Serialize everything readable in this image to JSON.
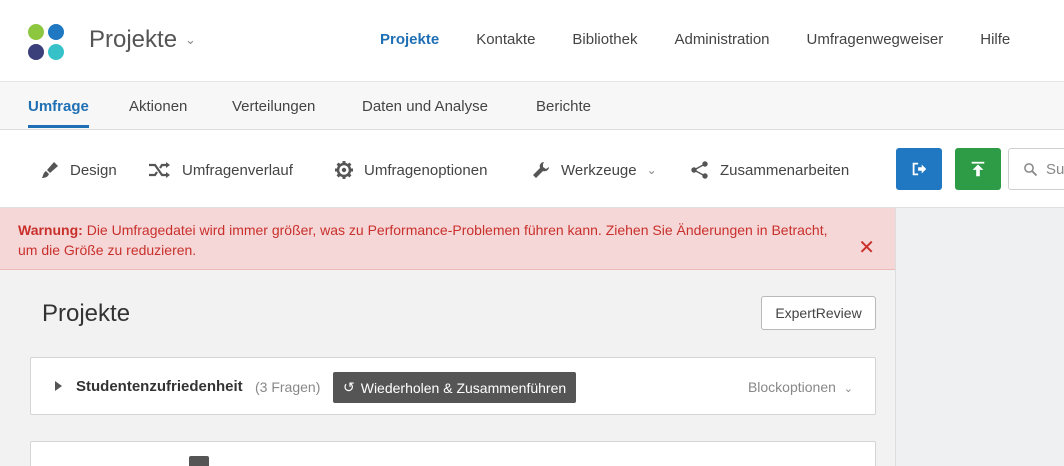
{
  "header": {
    "project_title": "Projekte",
    "logo_colors": [
      "#8dc63f",
      "#1f78c1",
      "#3b3f7a",
      "#37c2c9"
    ],
    "nav": [
      {
        "label": "Projekte",
        "active": true
      },
      {
        "label": "Kontakte"
      },
      {
        "label": "Bibliothek"
      },
      {
        "label": "Administration"
      },
      {
        "label": "Umfragenwegweiser"
      },
      {
        "label": "Hilfe"
      }
    ]
  },
  "tabs": [
    {
      "label": "Umfrage",
      "active": true
    },
    {
      "label": "Aktionen"
    },
    {
      "label": "Verteilungen"
    },
    {
      "label": "Daten und Analyse"
    },
    {
      "label": "Berichte"
    }
  ],
  "toolbar": {
    "items": [
      {
        "label": "Design",
        "icon": "paintbrush-icon"
      },
      {
        "label": "Umfragenverlauf",
        "icon": "flow-shuffle-icon"
      },
      {
        "label": "Umfragenoptionen",
        "icon": "gear-icon"
      },
      {
        "label": "Werkzeuge",
        "icon": "wrench-icon"
      },
      {
        "label": "Zusammenarbeiten",
        "icon": "share-icon"
      }
    ],
    "search_placeholder": "Su"
  },
  "warning": {
    "prefix": "Warnung:",
    "message": "Die Umfragedatei wird immer größer, was zu Performance-Problemen führen kann. Ziehen Sie Änderungen in Betracht, um die Größe zu reduzieren."
  },
  "main": {
    "title": "Projekte",
    "expert_review_label": "ExpertReview",
    "blocks": [
      {
        "name": "Studentenzufriedenheit",
        "count": "(3 Fragen)",
        "merge_label": "Wiederholen & Zusammenführen",
        "options_label": "Blockoptionen"
      }
    ]
  },
  "colors": {
    "accent": "#1f6fb4",
    "warning_bg": "#f5d7d7",
    "warning_text": "#c9302c",
    "btn_blue": "#1f78c1",
    "btn_green": "#2e9c47"
  }
}
